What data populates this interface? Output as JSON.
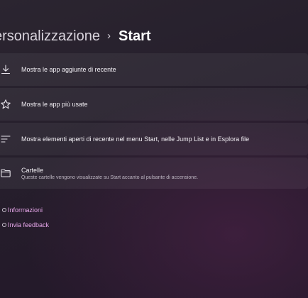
{
  "breadcrumb": {
    "parent": "ersonalizzazione",
    "separator": "›",
    "current": "Start"
  },
  "settings": [
    {
      "title": "Mostra le app aggiunte di recente",
      "icon": "download-icon"
    },
    {
      "title": "Mostra le app più usate",
      "icon": "star-icon"
    },
    {
      "title": "Mostra elementi aperti di recente nel menu Start, nelle Jump List e in Esplora file",
      "icon": "list-icon"
    },
    {
      "title": "Cartelle",
      "description": "Queste cartelle vengono visualizzate su Start accanto al pulsante di accensione.",
      "icon": "folder-icon"
    }
  ],
  "links": {
    "info": "Informazioni",
    "feedback": "Invia feedback"
  },
  "colors": {
    "accent_link": "#e6a6e9",
    "card_bg": "rgba(255,255,255,0.055)"
  }
}
